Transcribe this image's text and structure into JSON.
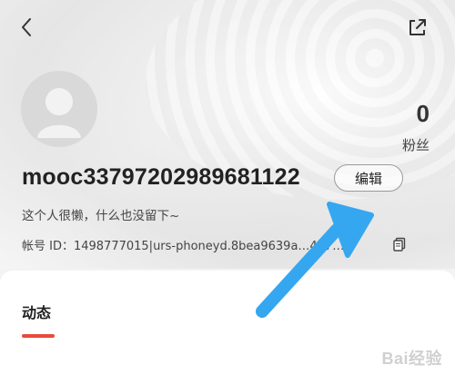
{
  "header": {
    "back_icon": "chevron-left-icon",
    "share_icon": "share-icon"
  },
  "profile": {
    "avatar_icon": "avatar-placeholder-icon",
    "fans_count": "0",
    "fans_label": "粉丝",
    "username": "mooc33797202989681122",
    "edit_label": "编辑",
    "bio": "这个人很懒，什么也没留下~",
    "account_text": "帐号 ID：1498777015|urs-phoneyd.8bea9639a…477…",
    "copy_icon": "copy-icon"
  },
  "tabs": {
    "active_label": "动态",
    "accent_color": "#e84a3b"
  },
  "overlay": {
    "arrow_color": "#35a7f0"
  },
  "watermark": {
    "text": "Bai经验"
  }
}
